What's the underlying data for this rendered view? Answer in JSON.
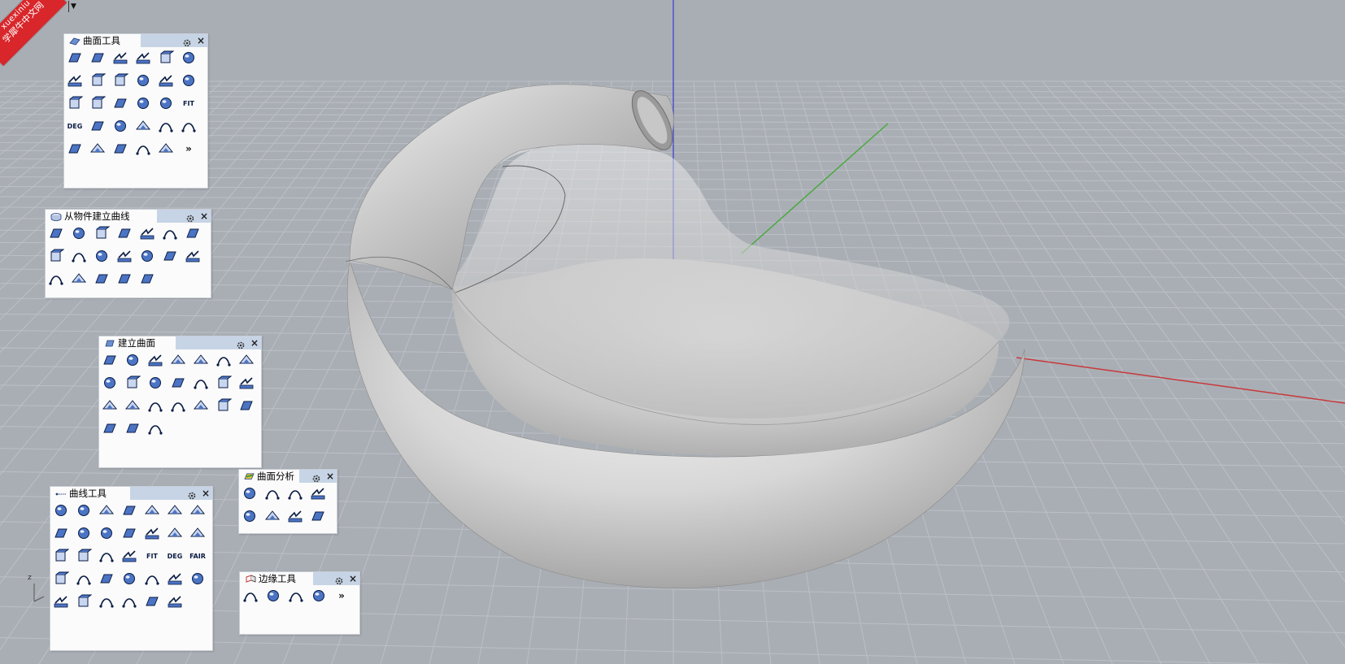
{
  "viewport": {
    "label": "ve",
    "dropdown_glyph": "▼",
    "axis_label_z": "z"
  },
  "watermark": {
    "line1": "xuexiniu",
    "line2": "学犀牛中文网"
  },
  "colors": {
    "x_axis": "#c8383a",
    "y_axis": "#4aa83e",
    "z_axis": "#3a3ad0",
    "grid": "#bcc0c6",
    "background": "#a9aeb4",
    "panel_head": "#c7d4e6"
  },
  "panels": {
    "surface_tools": {
      "title": "曲面工具",
      "tools": [
        "blend-surface",
        "match-surface",
        "fillet-surface",
        "chamfer-surface",
        "offset-surface",
        "extend-surface",
        "merge-surface",
        "rebuild-surface",
        "shrink-surface",
        "unroll",
        "split-surface",
        "adjust-seam",
        "untrim",
        "bend",
        "twist",
        "taper",
        "flow-along-surface",
        "FIT",
        "DEG",
        "project",
        "symmetry",
        "array-surface",
        "isocurve",
        "point-cloud",
        "explode",
        "cylinder-tool",
        "triangle-tool",
        "cage",
        "deform",
        "more"
      ]
    },
    "curve_from_objects": {
      "title": "从物件建立曲线",
      "tools": [
        "duplicate-edge",
        "duplicate-border",
        "project-to-surface",
        "pull-curve",
        "extract-wireframe",
        "contour",
        "section-points",
        "intersection",
        "silhouette",
        "extract-isocurve",
        "hatch",
        "create-uv",
        "wireframe-2d",
        "point-box",
        "points-grid",
        "scattered-points",
        "offset-curve",
        "explode-arrow",
        "draw-order"
      ]
    },
    "create_surface": {
      "title": "建立曲面",
      "tools": [
        "corner-points",
        "sphere-surf",
        "patch",
        "loft",
        "edge-surface",
        "sweep-1",
        "plane-grid",
        "rectangle-surf",
        "extrude",
        "network",
        "revolve",
        "rail-revolve",
        "heightfield",
        "cap",
        "dome",
        "cone",
        "pipe",
        "drape",
        "sweep-1-rail",
        "sweep-2-rails",
        "blossom",
        "ghost",
        "box-face",
        "dot-grid"
      ]
    },
    "curve_tools": {
      "title": "曲线工具",
      "tools": [
        "fillet-curve",
        "chamfer-curve",
        "blend-curve",
        "match-curve",
        "curve-through",
        "rebuild-curve",
        "arc-tool",
        "offset-curve",
        "extend-curve",
        "add-knot",
        "join-curves",
        "dashed-line",
        "adjust-end",
        "arrow-3d",
        "arc-connect",
        "cylinder-connect",
        "person-tool",
        "person-2",
        "FIT",
        "DEG",
        "FAIR",
        "point-set",
        "edit-points",
        "corner",
        "circle-center",
        "seam",
        "zigzag",
        "delete-point",
        "move-point",
        "hook",
        "polyline",
        "arc-small",
        "box-shape",
        "rotate-ring"
      ]
    },
    "surface_analysis": {
      "title": "曲面分析",
      "tools": [
        "curvature-analysis",
        "draft-analysis",
        "environment-map",
        "zebra",
        "edge-analysis",
        "emap",
        "thickness",
        "camera"
      ]
    },
    "edge_tools": {
      "title": "边缘工具",
      "tools": [
        "show-edges",
        "split-edge",
        "merge-edge",
        "rebuild-edges",
        "more"
      ]
    }
  }
}
